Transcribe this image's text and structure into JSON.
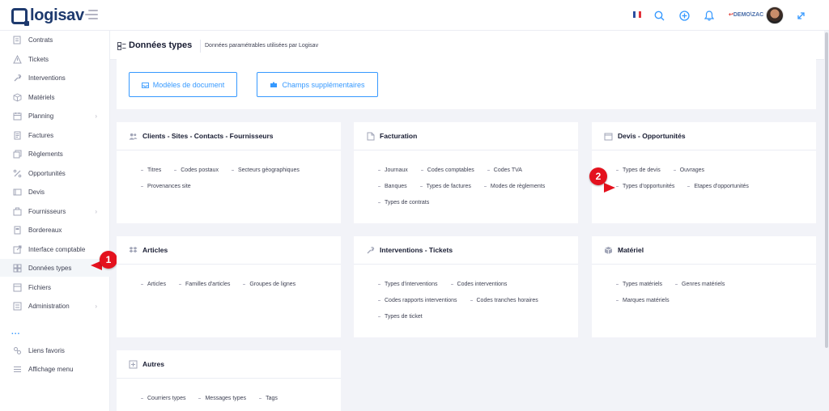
{
  "app": {
    "logo_text": "logisav",
    "user_label_prefix": "DEMO",
    "user_label_suffix": "ZAC"
  },
  "colors": {
    "accent": "#3699ff",
    "brand": "#1e3a6e",
    "marker": "#e4121e"
  },
  "header_icons": [
    "flag-icon",
    "search-icon",
    "add-circle-icon",
    "bell-icon",
    "user-switch-icon",
    "avatar",
    "expand-icon"
  ],
  "sidebar": {
    "items": [
      {
        "label": "Contrats",
        "icon": "contract-icon"
      },
      {
        "label": "Tickets",
        "icon": "warning-icon"
      },
      {
        "label": "Interventions",
        "icon": "wrench-icon"
      },
      {
        "label": "Matériels",
        "icon": "box-icon"
      },
      {
        "label": "Planning",
        "icon": "calendar-icon",
        "chevron": "›"
      },
      {
        "label": "Factures",
        "icon": "invoice-icon"
      },
      {
        "label": "Règlements",
        "icon": "payment-icon"
      },
      {
        "label": "Opportunités",
        "icon": "opportunity-icon"
      },
      {
        "label": "Devis",
        "icon": "quote-icon"
      },
      {
        "label": "Fournisseurs",
        "icon": "supplier-icon",
        "chevron": "›"
      },
      {
        "label": "Bordereaux",
        "icon": "slip-icon"
      },
      {
        "label": "Interface comptable",
        "icon": "external-link-icon"
      },
      {
        "label": "Données types",
        "icon": "grid-icon",
        "active": true
      },
      {
        "label": "Fichiers",
        "icon": "files-icon"
      },
      {
        "label": "Administration",
        "icon": "admin-icon",
        "chevron": "›"
      }
    ],
    "dots": "...",
    "bottom_items": [
      {
        "label": "Liens favoris",
        "icon": "link-icon"
      },
      {
        "label": "Affichage menu",
        "icon": "menu-icon"
      }
    ]
  },
  "page": {
    "title": "Données types",
    "subtitle": "Données paramétrables utilisées par Logisav"
  },
  "buttons": {
    "models": "Modèles de document",
    "extra_fields": "Champs supplémentaires"
  },
  "markers": {
    "one": "1",
    "two": "2"
  },
  "cards": [
    {
      "title": "Clients - Sites - Contacts - Fournisseurs",
      "icon": "users-icon",
      "rows": [
        [
          "Titres",
          "Codes postaux",
          "Secteurs géographiques"
        ],
        [
          "Provenances site"
        ]
      ]
    },
    {
      "title": "Facturation",
      "icon": "document-icon",
      "rows": [
        [
          "Journaux",
          "Codes comptables",
          "Codes TVA"
        ],
        [
          "Banques",
          "Types de factures",
          "Modes de règlements"
        ],
        [
          "Types de contrats"
        ]
      ]
    },
    {
      "title": "Devis - Opportunités",
      "icon": "folder-icon",
      "rows": [
        [
          "Types de devis",
          "Ouvrages"
        ],
        [
          "Types d'opportunités",
          "Etapes d'opportunités"
        ]
      ]
    },
    {
      "title": "Articles",
      "icon": "dropbox-icon",
      "rows": [
        [
          "Articles",
          "Familles d'articles",
          "Groupes de lignes"
        ]
      ]
    },
    {
      "title": "Interventions - Tickets",
      "icon": "wrench-icon",
      "rows": [
        [
          "Types d'interventions",
          "Codes interventions"
        ],
        [
          "Codes rapports interventions",
          "Codes tranches horaires"
        ],
        [
          "Types de ticket"
        ]
      ]
    },
    {
      "title": "Matériel",
      "icon": "cube-icon",
      "rows": [
        [
          "Types matériels",
          "Genres matériels"
        ],
        [
          "Marques matériels"
        ]
      ]
    },
    {
      "title": "Autres",
      "icon": "plus-square-icon",
      "rows": [
        [
          "Courriers types",
          "Messages types",
          "Tags"
        ]
      ]
    }
  ]
}
